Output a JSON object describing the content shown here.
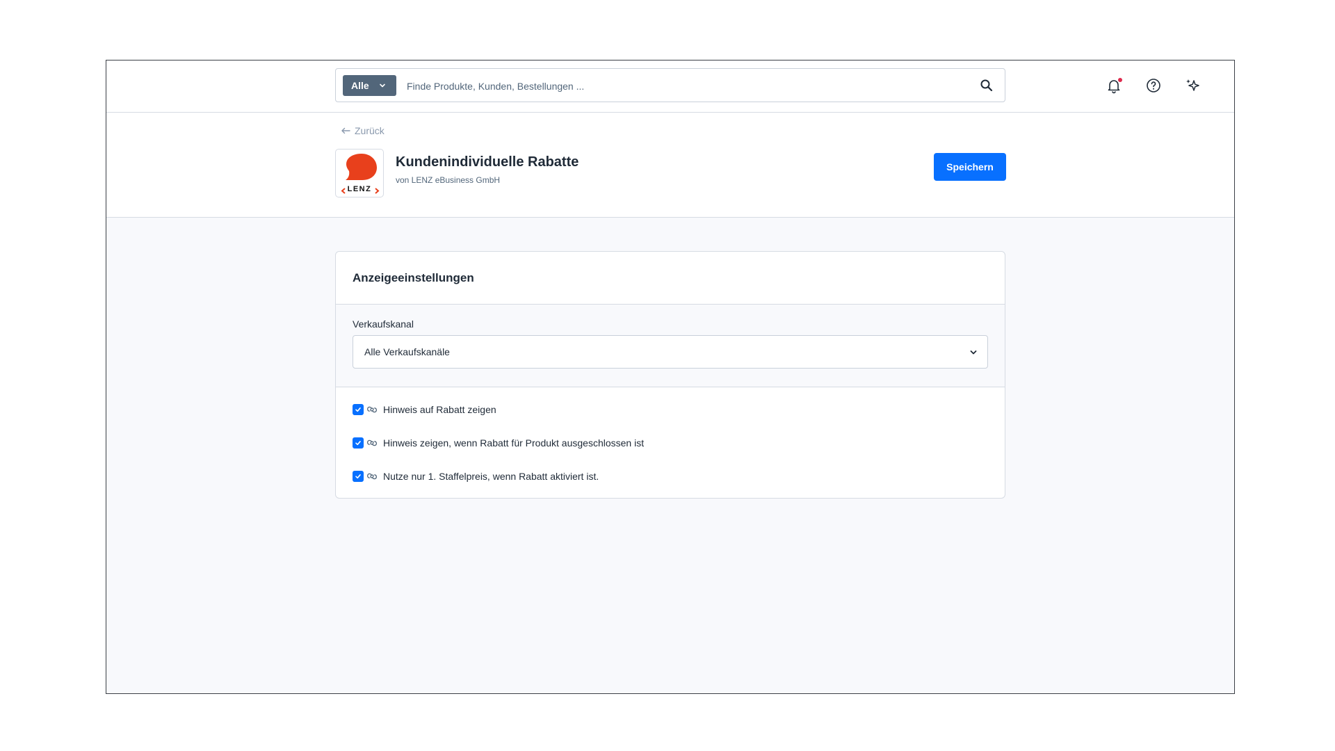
{
  "topbar": {
    "search_scope": "Alle",
    "search_placeholder": "Finde Produkte, Kunden, Bestellungen ..."
  },
  "header": {
    "back_label": "Zurück",
    "app_title": "Kundenindividuelle Rabatte",
    "app_vendor": "von LENZ eBusiness GmbH",
    "logo_text": "LENZ",
    "save_label": "Speichern"
  },
  "card": {
    "title": "Anzeigeeinstellungen",
    "sales_channel_label": "Verkaufskanal",
    "sales_channel_value": "Alle Verkaufskanäle",
    "options": [
      {
        "label": "Hinweis auf Rabatt zeigen",
        "checked": true
      },
      {
        "label": "Hinweis zeigen, wenn Rabatt für Produkt ausgeschlossen ist",
        "checked": true
      },
      {
        "label": "Nutze nur 1. Staffelpreis, wenn Rabatt aktiviert ist.",
        "checked": true
      }
    ]
  },
  "colors": {
    "primary": "#0870ff",
    "scope_button": "#52667a",
    "logo_red": "#e8401c",
    "notification_dot": "#de294c"
  },
  "icons": [
    "search-icon",
    "bell-icon",
    "help-icon",
    "sparkle-icon",
    "arrow-left-icon",
    "chevron-down-icon",
    "check-icon",
    "link-icon"
  ]
}
